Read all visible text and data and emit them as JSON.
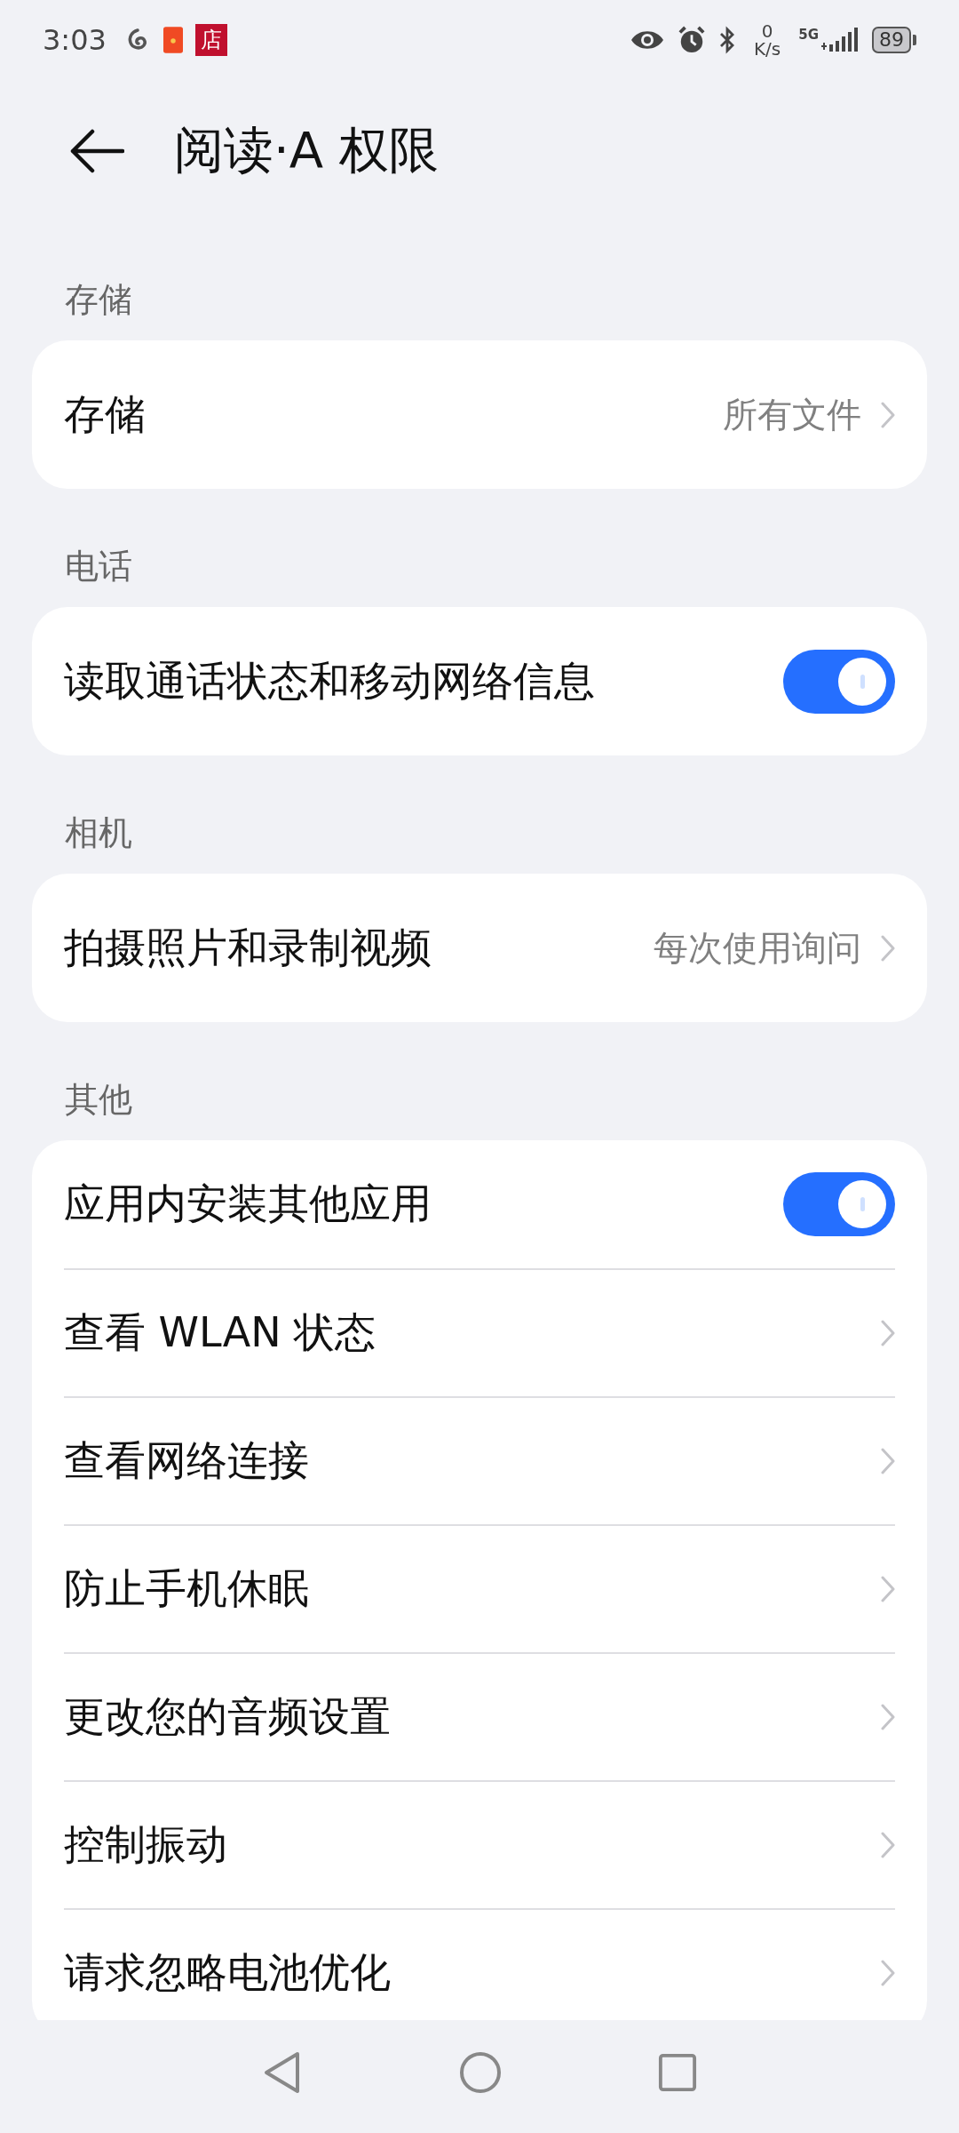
{
  "status_bar": {
    "time": "3:03",
    "store_badge": "店",
    "net_speed_value": "0",
    "net_speed_unit": "K/s",
    "network_type": "5G",
    "battery": "89"
  },
  "header": {
    "title": "阅读·A 权限"
  },
  "sections": [
    {
      "title": "存储",
      "items": [
        {
          "kind": "link",
          "label": "存储",
          "value": "所有文件"
        }
      ]
    },
    {
      "title": "电话",
      "items": [
        {
          "kind": "toggle",
          "label": "读取通话状态和移动网络信息",
          "on": true
        }
      ]
    },
    {
      "title": "相机",
      "items": [
        {
          "kind": "link",
          "label": "拍摄照片和录制视频",
          "value": "每次使用询问"
        }
      ]
    },
    {
      "title": "其他",
      "items": [
        {
          "kind": "toggle",
          "label": "应用内安装其他应用",
          "on": true
        },
        {
          "kind": "link",
          "label": "查看 WLAN 状态"
        },
        {
          "kind": "link",
          "label": "查看网络连接"
        },
        {
          "kind": "link",
          "label": "防止手机休眠"
        },
        {
          "kind": "link",
          "label": "更改您的音频设置"
        },
        {
          "kind": "link",
          "label": "控制振动"
        },
        {
          "kind": "link",
          "label": "请求忽略电池优化"
        }
      ]
    }
  ]
}
